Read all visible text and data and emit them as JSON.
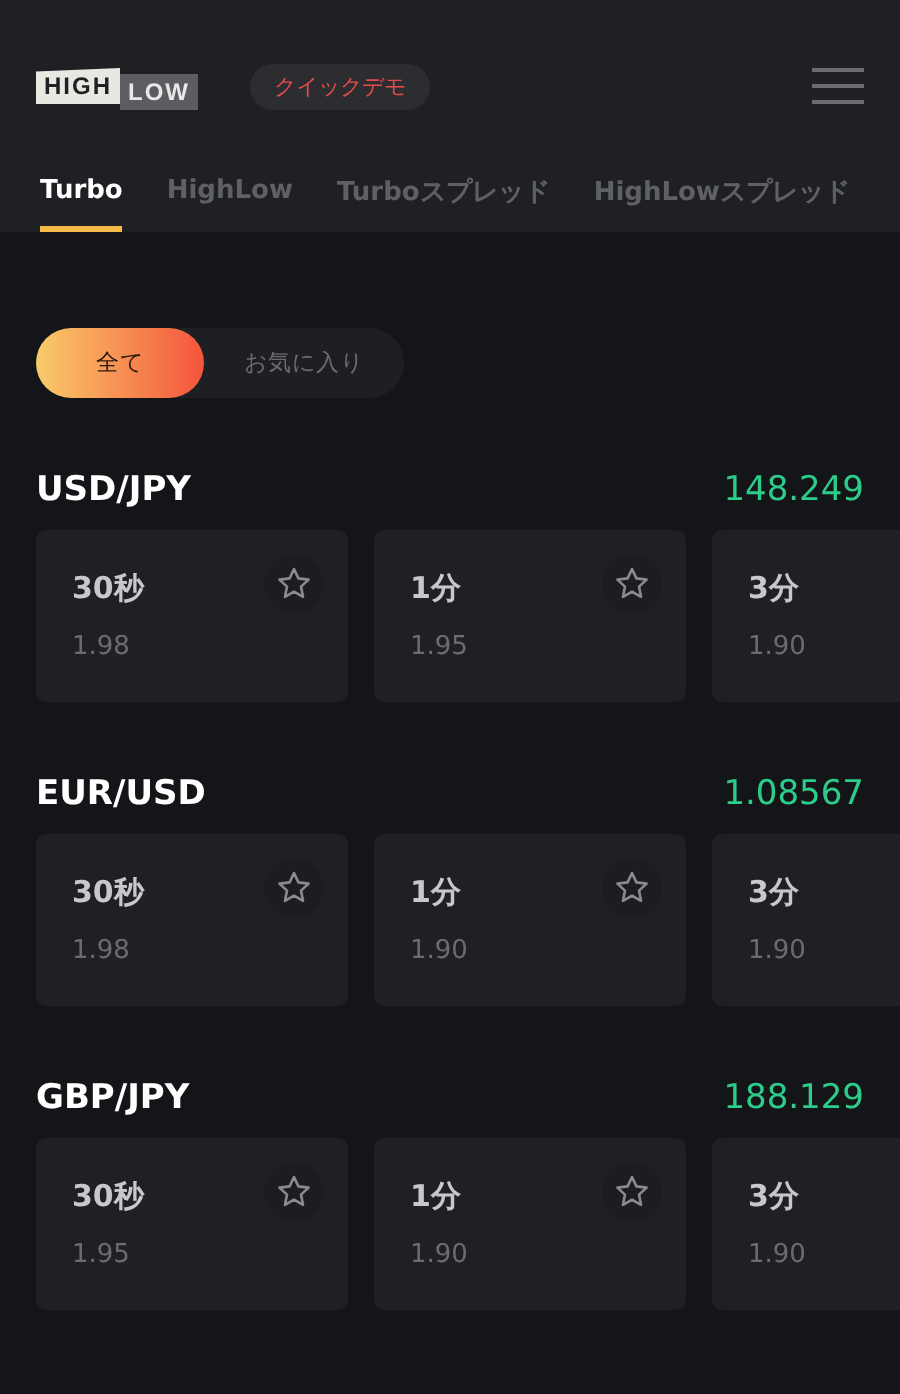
{
  "header": {
    "logo": [
      "HIGH",
      "LOW"
    ],
    "demo_badge": "クイックデモ"
  },
  "tabs": [
    {
      "label": "Turbo",
      "selected": true
    },
    {
      "label": "HighLow",
      "selected": false
    },
    {
      "label": "Turboスプレッド",
      "selected": false
    },
    {
      "label": "HighLowスプレッド",
      "selected": false
    }
  ],
  "filters": [
    {
      "label": "全て",
      "selected": true
    },
    {
      "label": "お気に入り",
      "selected": false
    }
  ],
  "pairs": [
    {
      "name": "USD/JPY",
      "rate": "148.249",
      "options": [
        {
          "duration": "30秒",
          "payout": "1.98",
          "favorite": false
        },
        {
          "duration": "1分",
          "payout": "1.95",
          "favorite": false
        },
        {
          "duration": "3分",
          "payout": "1.90"
        }
      ]
    },
    {
      "name": "EUR/USD",
      "rate": "1.08567",
      "options": [
        {
          "duration": "30秒",
          "payout": "1.98",
          "favorite": false
        },
        {
          "duration": "1分",
          "payout": "1.90",
          "favorite": false
        },
        {
          "duration": "3分",
          "payout": "1.90"
        }
      ]
    },
    {
      "name": "GBP/JPY",
      "rate": "188.129",
      "options": [
        {
          "duration": "30秒",
          "payout": "1.95",
          "favorite": false
        },
        {
          "duration": "1分",
          "payout": "1.90",
          "favorite": false
        },
        {
          "duration": "3分",
          "payout": "1.90"
        }
      ]
    }
  ]
}
